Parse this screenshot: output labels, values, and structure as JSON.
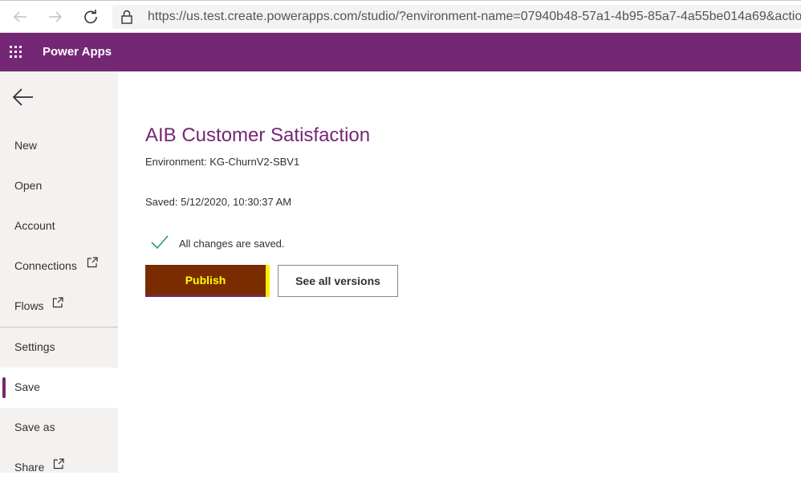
{
  "browser": {
    "url": "https://us.test.create.powerapps.com/studio/?environment-name=07940b48-57a1-4b95-85a7-4a55be014a69&action"
  },
  "header": {
    "app_title": "Power Apps",
    "color": "#742774"
  },
  "sidebar": {
    "items": [
      {
        "label": "New"
      },
      {
        "label": "Open"
      },
      {
        "label": "Account"
      },
      {
        "label": "Connections"
      },
      {
        "label": "Flows"
      },
      {
        "label": "Settings"
      },
      {
        "label": "Save"
      },
      {
        "label": "Save as"
      },
      {
        "label": "Share"
      }
    ],
    "active_item": "Save"
  },
  "main": {
    "title": "AIB Customer Satisfaction",
    "environment": "Environment: KG-ChurnV2-SBV1",
    "saved": "Saved: 5/12/2020, 10:30:37 AM",
    "status": "All changes are saved.",
    "publish_label": "Publish",
    "versions_label": "See all versions"
  },
  "colors": {
    "accent": "#742774",
    "publish_bg": "#7a2c00",
    "publish_text": "#ffff00",
    "check": "#2e9e5b"
  },
  "icons": {
    "back": "back-arrow-icon",
    "refresh": "refresh-icon",
    "lock": "lock-icon",
    "waffle": "waffle-icon",
    "external": "open-external-icon",
    "check": "checkmark-icon"
  }
}
